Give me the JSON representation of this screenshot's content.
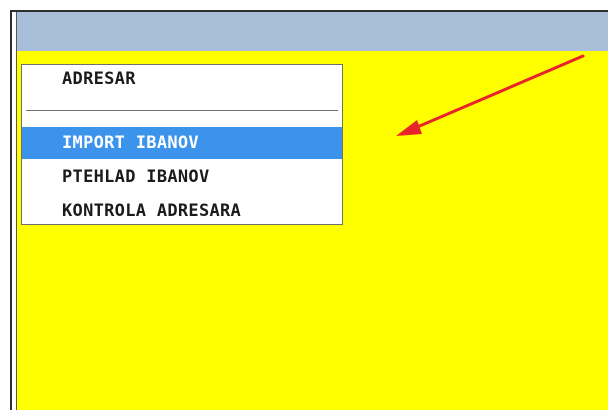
{
  "menu": {
    "title": "ADRESAR",
    "items": [
      {
        "label": "IMPORT IBANOV",
        "selected": true
      },
      {
        "label": "PTEHLAD IBANOV",
        "selected": false
      },
      {
        "label": "KONTROLA ADRESARA",
        "selected": false
      }
    ]
  },
  "colors": {
    "workspace": "#ffff00",
    "titlebar": "#a9bed9",
    "selection": "#3b93ec",
    "annotation_arrow": "#e8242a"
  },
  "annotation": {
    "icon": "arrow-pointer-icon"
  }
}
